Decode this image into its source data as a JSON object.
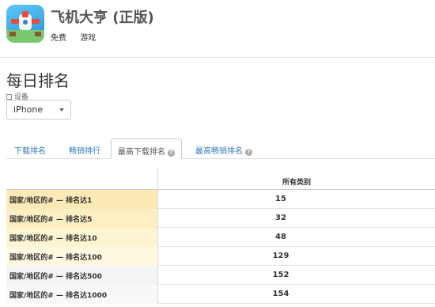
{
  "app": {
    "title": "飞机大亨 (正版)",
    "price": "免费",
    "category": "游戏"
  },
  "section": {
    "title": "每日排名",
    "device_label": "设备",
    "device_value": "iPhone"
  },
  "tabs": [
    {
      "label": "下载排名",
      "active": false
    },
    {
      "label": "畅销排行",
      "active": false
    },
    {
      "label": "最高下载排名",
      "active": true,
      "help": true
    },
    {
      "label": "最高畅销排名",
      "active": false,
      "help": true
    }
  ],
  "table": {
    "column_header": "所有类别",
    "rows": [
      {
        "label": "国家/地区的# — 排名达1",
        "value": "15",
        "color": "#fde9b5"
      },
      {
        "label": "国家/地区的# — 排名达5",
        "value": "32",
        "color": "#fdefc3"
      },
      {
        "label": "国家/地区的# — 排名达10",
        "value": "48",
        "color": "#fdf4d2"
      },
      {
        "label": "国家/地区的# — 排名达100",
        "value": "129",
        "color": "#fef9e0"
      },
      {
        "label": "国家/地区的# — 排名达500",
        "value": "152",
        "color": "#f4f4f4"
      },
      {
        "label": "国家/地区的# — 排名达1000",
        "value": "154",
        "color": "#f8f8f8"
      }
    ]
  }
}
